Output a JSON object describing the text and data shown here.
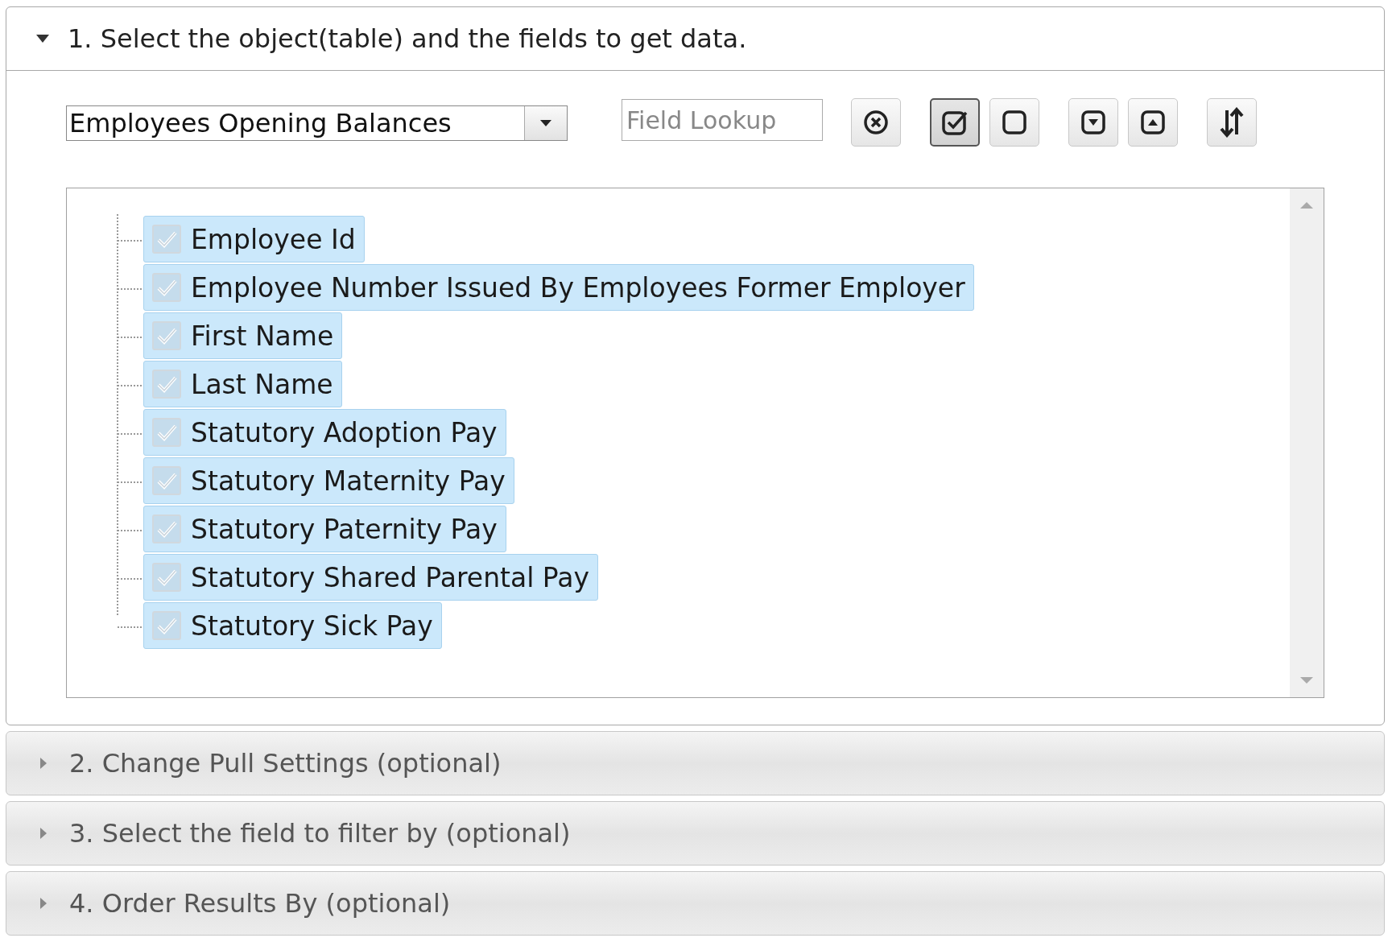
{
  "panels": [
    {
      "title": "1. Select the object(table) and the fields to get data.",
      "expanded": true
    },
    {
      "title": "2. Change Pull Settings (optional)",
      "expanded": false
    },
    {
      "title": "3. Select the field to filter by (optional)",
      "expanded": false
    },
    {
      "title": "4. Order Results By (optional)",
      "expanded": false
    }
  ],
  "object_select": {
    "value": "Employees Opening Balances"
  },
  "field_lookup": {
    "placeholder": "Field Lookup"
  },
  "toolbar": [
    {
      "kind": "clear",
      "selected": false
    },
    {
      "kind": "check-all",
      "selected": true
    },
    {
      "kind": "uncheck-all",
      "selected": false
    },
    {
      "kind": "expand",
      "selected": false
    },
    {
      "kind": "collapse",
      "selected": false
    },
    {
      "kind": "sort",
      "selected": false
    }
  ],
  "fields": [
    {
      "label": "Employee Id",
      "checked": true
    },
    {
      "label": "Employee Number Issued By Employees Former Employer",
      "checked": true
    },
    {
      "label": "First Name",
      "checked": true
    },
    {
      "label": "Last Name",
      "checked": true
    },
    {
      "label": "Statutory Adoption Pay",
      "checked": true
    },
    {
      "label": "Statutory Maternity Pay",
      "checked": true
    },
    {
      "label": "Statutory Paternity Pay",
      "checked": true
    },
    {
      "label": "Statutory Shared Parental Pay",
      "checked": true
    },
    {
      "label": "Statutory Sick Pay",
      "checked": true
    }
  ]
}
